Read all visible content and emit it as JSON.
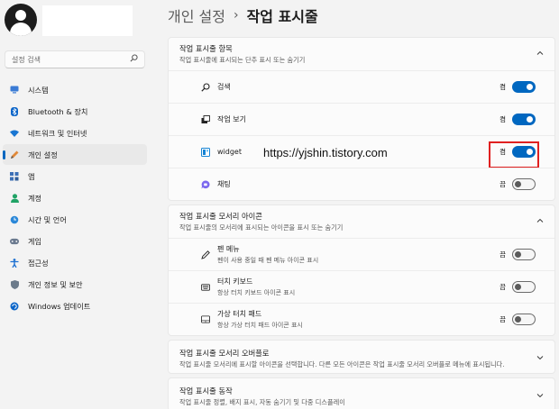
{
  "sidebar": {
    "search_placeholder": "설정 검색",
    "items": [
      {
        "label": "시스템",
        "icon": "monitor-icon"
      },
      {
        "label": "Bluetooth & 장치",
        "icon": "bluetooth-icon"
      },
      {
        "label": "네트워크 및 인터넷",
        "icon": "wifi-icon"
      },
      {
        "label": "개인 설정",
        "icon": "pen-icon",
        "active": true
      },
      {
        "label": "앱",
        "icon": "apps-icon"
      },
      {
        "label": "계정",
        "icon": "person-icon"
      },
      {
        "label": "시간 및 언어",
        "icon": "globe-clock-icon"
      },
      {
        "label": "게임",
        "icon": "gamepad-icon"
      },
      {
        "label": "접근성",
        "icon": "accessibility-icon"
      },
      {
        "label": "개인 정보 및 보안",
        "icon": "shield-icon"
      },
      {
        "label": "Windows 업데이트",
        "icon": "update-icon"
      }
    ]
  },
  "header": {
    "parent": "개인 설정",
    "separator": "›",
    "current": "작업 표시줄"
  },
  "groups": {
    "taskbar_items": {
      "title": "작업 표시줄 항목",
      "subtitle": "작업 표시줄에 표시되는 단추 표시 또는 숨기기",
      "rows": [
        {
          "label": "검색",
          "state": "켬",
          "on": true,
          "icon": "search-icon"
        },
        {
          "label": "작업 보기",
          "state": "켬",
          "on": true,
          "icon": "task-view-icon"
        },
        {
          "label": "widget",
          "state": "켬",
          "on": true,
          "icon": "widgets-icon"
        },
        {
          "label": "채팅",
          "state": "끔",
          "on": false,
          "icon": "chat-icon"
        }
      ]
    },
    "corner_icons": {
      "title": "작업 표시줄 모서리 아이콘",
      "subtitle": "작업 표시줄의 모서리에 표시되는 아이콘을 표시 또는 숨기기",
      "rows": [
        {
          "label": "펜 메뉴",
          "sub": "펜이 사용 중일 때 펜 메뉴 아이콘 표시",
          "state": "끔",
          "on": false,
          "icon": "pen-menu-icon"
        },
        {
          "label": "터치 키보드",
          "sub": "항상 터치 키보드 아이콘 표시",
          "state": "끔",
          "on": false,
          "icon": "keyboard-icon"
        },
        {
          "label": "가상 터치 패드",
          "sub": "항상 가상 터치 패드 아이콘 표시",
          "state": "끔",
          "on": false,
          "icon": "touchpad-icon"
        }
      ]
    },
    "corner_overflow": {
      "title": "작업 표시줄 모서리 오버플로",
      "subtitle": "작업 표시줄 모서리에 표시할 아이콘을 선택합니다. 다른 모든 아이콘은 작업 표시줄 모서리 오버플로 메뉴에 표시됩니다."
    },
    "behaviors": {
      "title": "작업 표시줄 동작",
      "subtitle": "작업 표시줄 정렬, 배지 표시, 자동 숨기기 및 다중 디스플레이"
    }
  },
  "watermark": "https://yjshin.tistory.com",
  "colors": {
    "accent": "#0067c0",
    "highlight_border": "#e02020"
  }
}
